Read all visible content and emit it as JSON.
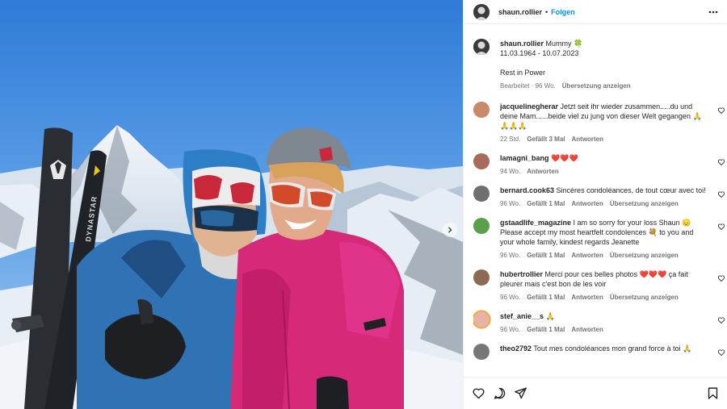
{
  "post": {
    "author": "shaun.rollier",
    "follow_label": "Folgen",
    "separator": "•",
    "caption_text": "Mummy 🍀",
    "caption_dates": "11.03.1964 - 10.07.2023",
    "caption_line2": "Rest in Power",
    "meta_edited": "Bearbeitet · 96 Wo.",
    "meta_translate": "Übersetzung anzeigen"
  },
  "photo": {
    "ski_brand": "DYNASTAR"
  },
  "comments": [
    {
      "user": "jacquelinegherar",
      "text": "Jetzt seit ihr wieder zusammen.....du und deine Mam......beide viel zu jung von dieser Welt gegangen 🙏 🙏🙏🙏",
      "meta": [
        "22 Std.",
        "Gefällt 3 Mal",
        "Antworten"
      ]
    },
    {
      "user": "lamagni_bang",
      "text": "❤️❤️❤️",
      "meta": [
        "94 Wo.",
        "Antworten"
      ]
    },
    {
      "user": "bernard.cook63",
      "text": "Sincères condoléances, de tout cœur avec toi!",
      "meta": [
        "96 Wo.",
        "Gefällt 1 Mal",
        "Antworten",
        "Übersetzung anzeigen"
      ]
    },
    {
      "user": "gstaadlife_magazine",
      "text": "I am so sorry for your loss Shaun 😞 Please accept my most heartfelt condolences 💐 to you and your whole family, kindest regards Jeanette",
      "meta": [
        "96 Wo.",
        "Gefällt 1 Mal",
        "Antworten",
        "Übersetzung anzeigen"
      ]
    },
    {
      "user": "hubertrollier",
      "text": "Merci pour ces belles photos ❤️❤️❤️ ça fait pleurer mais c'est bon de les voir",
      "meta": [
        "96 Wo.",
        "Gefällt 1 Mal",
        "Antworten",
        "Übersetzung anzeigen"
      ]
    },
    {
      "user": "stef_anie__s",
      "text": "🙏",
      "meta": [
        "96 Wo.",
        "Gefällt 1 Mal",
        "Antworten"
      ]
    },
    {
      "user": "theo2792",
      "text": "Tout mes condoléances mon grand force à toi 🙏",
      "meta": []
    }
  ],
  "colors": {
    "accent": "#0095f6",
    "muted": "#737373",
    "jacket_pink": "#d62a78",
    "jacket_blue": "#2f73b5"
  },
  "icons": {
    "more": "more-horizontal-icon",
    "heart": "heart-icon",
    "comment": "comment-icon",
    "share": "share-icon",
    "save": "bookmark-icon",
    "next": "chevron-right-icon"
  }
}
